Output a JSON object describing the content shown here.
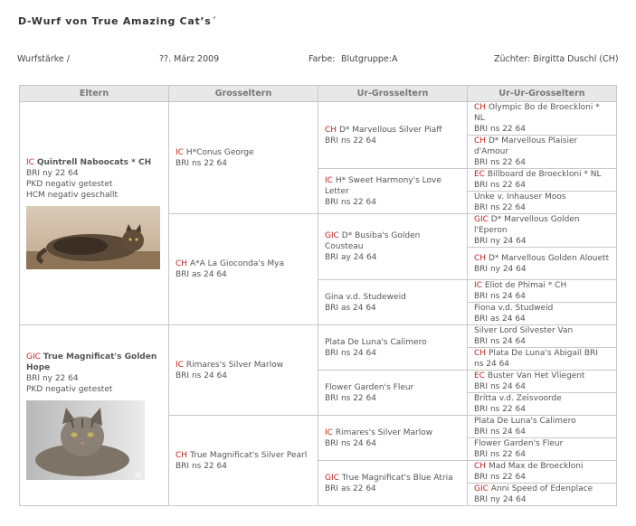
{
  "page": {
    "title": "D-Wurf von True Amazing Cat’s´",
    "litter_label": "Wurfstärke  /",
    "date": "??. März 2009",
    "color_label": "Farbe:",
    "color_value": "Blutgruppe:A",
    "breeder": "Züchter: Birgitta Duschl (CH)"
  },
  "headers": [
    "Eltern",
    "Grosseltern",
    "Ur-Grosseltern",
    "Ur-Ur-Grosseltern"
  ],
  "parents": [
    {
      "title": "IC",
      "name": "Quintrell Naboocats * CH",
      "lines": [
        "BRI ny 22 64",
        "PKD negativ getestet",
        "HCM negativ geschallt"
      ]
    },
    {
      "title": "GIC",
      "name": "True Magnificat's Golden Hope",
      "lines": [
        "BRI ny 22 64",
        "PKD negativ getestet"
      ]
    }
  ],
  "grandparents": [
    {
      "title": "IC",
      "name": "H*Conus George",
      "code": "BRI ns 22 64"
    },
    {
      "title": "CH",
      "name": "A*A La Gioconda's Mya",
      "code": "BRI as 24 64"
    },
    {
      "title": "IC",
      "name": "Rimares's Silver Marlow",
      "code": "BRI ns 24 64"
    },
    {
      "title": "CH",
      "name": "True Magnificat's Silver Pearl",
      "code": "BRI ns 22 64"
    }
  ],
  "great_grandparents": [
    {
      "title": "CH",
      "name": "D* Marvellous Silver Piaff",
      "code": "BRI ns 22 64"
    },
    {
      "title": "IC",
      "name": "H* Sweet Harmony's Love Letter",
      "code": "BRI ns 22 64"
    },
    {
      "title": "GIC",
      "name": "D* Busiba's Golden Cousteau",
      "code": "BRI ay 24 64"
    },
    {
      "title": "",
      "name": "Gina v.d. Studeweid",
      "code": "BRI as 24 64"
    },
    {
      "title": "",
      "name": "Plata De Luna's Calimero",
      "code": "BRI ns 24 64"
    },
    {
      "title": "",
      "name": "Flower Garden's Fleur",
      "code": "BRI ns 22 64"
    },
    {
      "title": "IC",
      "name": "Rimares's Silver Marlow",
      "code": "BRI ns 24 64"
    },
    {
      "title": "GIC",
      "name": "True Magnificat's Blue Atria",
      "code": "BRI as 22 64"
    }
  ],
  "great_great_grandparents": [
    {
      "title": "CH",
      "name": "Olympic Bo de Broeckloni * NL",
      "code": "BRI ns 22 64"
    },
    {
      "title": "CH",
      "name": "D* Marvellous Plaisier d'Amour",
      "code": "BRI ns 22 64"
    },
    {
      "title": "EC",
      "name": "Billboard de Broeckloni * NL",
      "code": "BRI ns 22 64"
    },
    {
      "title": "",
      "name": "Unke v. Inhauser Moos",
      "code": "BRI ns 22 64"
    },
    {
      "title": "GIC",
      "name": "D* Marvellous Golden l'Eperon",
      "code": "BRI ny 24 64"
    },
    {
      "title": "CH",
      "name": "D* Marvellous Golden Alouett",
      "code": "BRI ny 24 64"
    },
    {
      "title": "IC",
      "name": "Eliot de Phimai * CH",
      "code": "BRI ns 24 64"
    },
    {
      "title": "",
      "name": "Fiona v.d. Studweid",
      "code": "BRI as 24 64"
    },
    {
      "title": "",
      "name": "Silver Lord Silvester Van",
      "code": "BRI ns 24 64"
    },
    {
      "title": "CH",
      "name": "Plata De Luna's Abigail BRI",
      "code": "ns 24 64"
    },
    {
      "title": "EC",
      "name": "Buster Van Het Vliegent",
      "code": "BRI ns 24 64"
    },
    {
      "title": "",
      "name": "Britta v.d. Zeisvoorde",
      "code": "BRI ns 22  64"
    },
    {
      "title": "",
      "name": "Plata De Luna's Calimero",
      "code": "BRI ns 24 64"
    },
    {
      "title": "",
      "name": "Flower Garden's Fleur",
      "code": "BRI ns 22 64"
    },
    {
      "title": "CH",
      "name": "Mad Max de Broeckloni",
      "code": "BRI ns 22 64"
    },
    {
      "title": "GIC",
      "name": "Anni Speed of Edenplace",
      "code": "BRI ny 24 64"
    }
  ]
}
